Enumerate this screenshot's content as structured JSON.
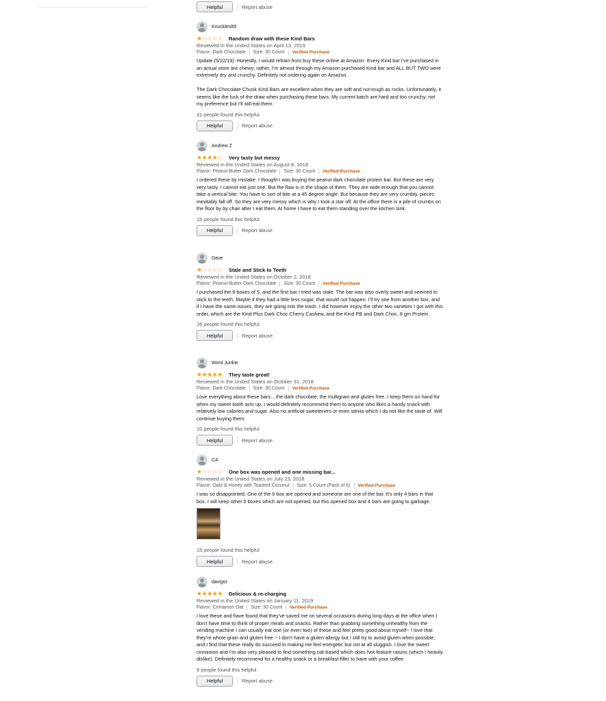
{
  "action_labels": {
    "helpful": "Helpful",
    "report": "Report abuse"
  },
  "reviews": [
    {
      "author": "Knuckles89",
      "rating": 1,
      "stars_full": "★",
      "stars_empty": "☆☆☆☆",
      "title": "Random draw with these Kind Bars",
      "date": "Reviewed in the United States on April 13, 2019",
      "flavor": "Flavor: Dark Chocolate",
      "size": "Size: 30 Count",
      "verified": "Verified Purchase",
      "body_1": "Update (5/22/19): Honestly, I would refrain from buy these online at Amazon. Every Kind bar I've purchased in an actual store are chewy; rather, I'm almost through my Amazon purchased Kind bar and ALL BUT TWO were extremely dry and crunchy. Definitely not ordering again on Amazon.",
      "body_2": "The Dark Chocolate Chunk Kind Bars are excellent when they are soft and not tough as rocks. Unfortunately, it seems like the luck of the draw when purchasing these bars. My current batch are hard and too crunchy, not my preference but I'll still eat them.",
      "helpful": "31 people found this helpful"
    },
    {
      "author": "Andrew Z",
      "rating": 4,
      "stars_full": "★★★★",
      "stars_empty": "☆",
      "title": "Very tasty but messy",
      "date": "Reviewed in the United States on August 8, 2018",
      "flavor": "Flavor: Peanut Butter Dark Chocolate",
      "size": "Size: 30 Count",
      "verified": "Verified Purchase",
      "body_1": "I ordered these by mistake. I thought I was buying the peanut dark chocolate protein bar. But these are very very tasty. I cannot eat just one. But the flaw is in the shape of them. They are wide enough that you cannot take a vertical bite. You have to sort of bite at a 45 degree angle. But because they are very crumbly, pieces inevitably fall off. So they are very messy which is why I took a star off. At the office there is a pile of crumbs on the floor by by chair after I eat them. At home I have to eat them standing over the kitchen sink.",
      "helpful": "16 people found this helpful"
    },
    {
      "author": "Dave",
      "rating": 1,
      "stars_full": "★",
      "stars_empty": "☆☆☆☆",
      "title": "Stale and Stick to Teeth",
      "date": "Reviewed in the United States on October 2, 2018",
      "flavor": "Flavor: Peanut Butter Dark Chocolate",
      "size": "Size: 30 Count",
      "verified": "Verified Purchase",
      "body_1": "I purchased the 6 boxes of 5, and the first bar I tried was stale. The bar was also overly sweet and seemed to stick to the teeth. Maybe if they had a little less sugar, that would not happen. I'll try one from another box, and if I have the same issues, they are going into the trash. I did however enjoy the other two varieties I got with this order, which are the Kind Plus Dark Choc Cherry Cashew, and the Kind PB and Dark Choc, 8 gm Protein.",
      "helpful": "16 people found this helpful"
    },
    {
      "author": "Word Junkie",
      "rating": 5,
      "stars_full": "★★★★★",
      "stars_empty": "",
      "title": "They taste great!",
      "date": "Reviewed in the United States on October 31, 2018",
      "flavor": "Flavor: Dark Chocolate",
      "size": "Size: 30 Count",
      "verified": "Verified Purchase",
      "body_1": "Love everything about these bars....the dark chocolate, the multigrain and gluten free. I keep them on hand for when my sweet tooth acts up. I would definitely recommend them to anyone who likes a handy snack with relatively low calories and sugar. Also no artificial sweeteners or even stevia which I do not like the taste of. Will continue buying them.",
      "helpful": "10 people found this helpful"
    },
    {
      "author": "CA",
      "rating": 1,
      "stars_full": "★",
      "stars_empty": "☆☆☆☆",
      "title": "One box was opened and one missing bar...",
      "date": "Reviewed in the United States on July 23, 2018",
      "flavor": "Flavor: Oats & Honey with Toasted Coconut",
      "size": "Size: 5 Count (Pack of 6)",
      "verified": "Verified Purchase",
      "body_1": "I was so disappointed. One of the 6 box are opened and someone are one of the bar. It's only 4 bars in that box. I will keep other 5 boxes which are not opened, but this opened box and 4 bars are going to garbage.",
      "helpful": "15 people found this helpful"
    },
    {
      "author": "davigor",
      "rating": 5,
      "stars_full": "★★★★★",
      "stars_empty": "",
      "title": "Delicious & re-charging",
      "date": "Reviewed in the United States on January 11, 2019",
      "flavor": "Flavor: Cinnamon Oat",
      "size": "Size: 30 Count",
      "verified": "Verified Purchase",
      "body_1": "I love these and have found that they've saved me on several occasions during long days at the office when I don't have time to think of proper meals and snacks. Rather than grabbing something unhealthy from the vending machine I can usually eat one (or even two) of these and feel pretty good about myself~ I love that they're whole grain and gluten free -- I don't have a gluten allergy but I still try to avoid gluten when possible, and I find that these really do succeed in making me feel energetic but not at all sluggish. I love the sweet cinnamon and I'm also very pleased to find something oat-based which does Not feature raisins (which I heavily dislike). Definitely recommend for a healthy snack or a breakfast-filler to have with your coffee.",
      "helpful": "9 people found this helpful"
    }
  ]
}
